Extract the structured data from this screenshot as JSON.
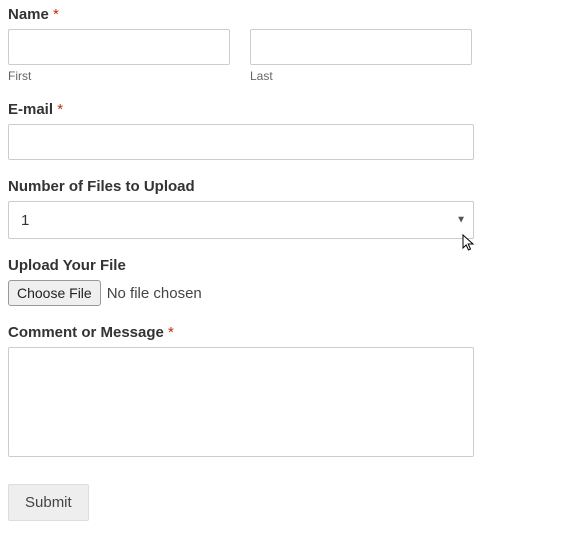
{
  "fields": {
    "name": {
      "label": "Name",
      "required": true,
      "first": {
        "value": "",
        "sublabel": "First"
      },
      "last": {
        "value": "",
        "sublabel": "Last"
      }
    },
    "email": {
      "label": "E-mail",
      "required": true,
      "value": ""
    },
    "num_files": {
      "label": "Number of Files to Upload",
      "required": false,
      "selected": "1"
    },
    "upload": {
      "label": "Upload Your File",
      "required": false,
      "button": "Choose File",
      "status": "No file chosen"
    },
    "comment": {
      "label": "Comment or Message",
      "required": true,
      "value": ""
    }
  },
  "required_mark": "*",
  "submit_label": "Submit"
}
